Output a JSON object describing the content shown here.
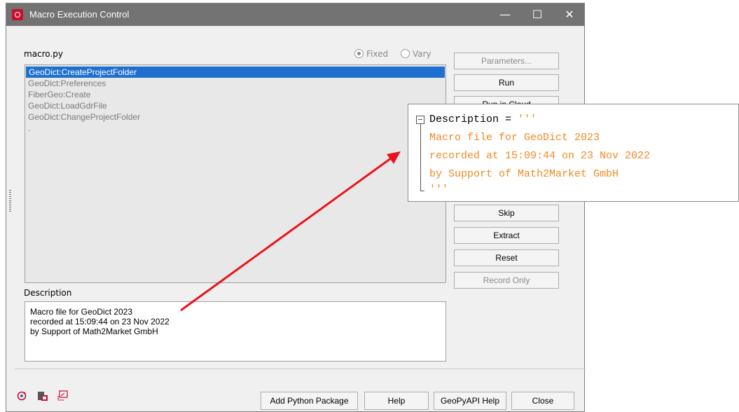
{
  "window": {
    "title": "Macro Execution Control",
    "controls": {
      "minimize": "—",
      "maximize": "☐",
      "close": "✕"
    }
  },
  "macro": {
    "file_label": "macro.py",
    "mode": {
      "fixed_label": "Fixed",
      "vary_label": "Vary",
      "selected": "Fixed"
    },
    "steps": [
      "GeoDict:CreateProjectFolder",
      "GeoDict:Preferences",
      "FiberGeo:Create",
      "GeoDict:LoadGdrFile",
      "GeoDict:ChangeProjectFolder",
      "."
    ],
    "selected_index": 0
  },
  "description": {
    "label": "Description",
    "lines": [
      "Macro file for GeoDict 2023",
      "recorded at 15:09:44 on 23 Nov 2022",
      "by Support of Math2Market GmbH"
    ]
  },
  "buttons": {
    "parameters": "Parameters...",
    "run": "Run",
    "run_in_cloud": "Run in Cloud",
    "skip": "Skip",
    "extract": "Extract",
    "reset": "Reset",
    "record_only": "Record Only"
  },
  "footer": {
    "add_python_package": "Add Python Package",
    "help": "Help",
    "geopyapi_help": "GeoPyAPI Help",
    "close": "Close"
  },
  "code_popup": {
    "line1_name": "Description",
    "line1_op": " = ",
    "line1_quote": "'''",
    "body": [
      "Macro file for GeoDict 2023",
      "recorded at 15:09:44 on 23 Nov 2022",
      "by Support of Math2Market GmbH"
    ],
    "closing_quote": "'''"
  },
  "colors": {
    "selection": "#1f6fd1",
    "titlebar": "#737373",
    "arrow": "#e8141c",
    "string_literal": "#f08a24"
  }
}
